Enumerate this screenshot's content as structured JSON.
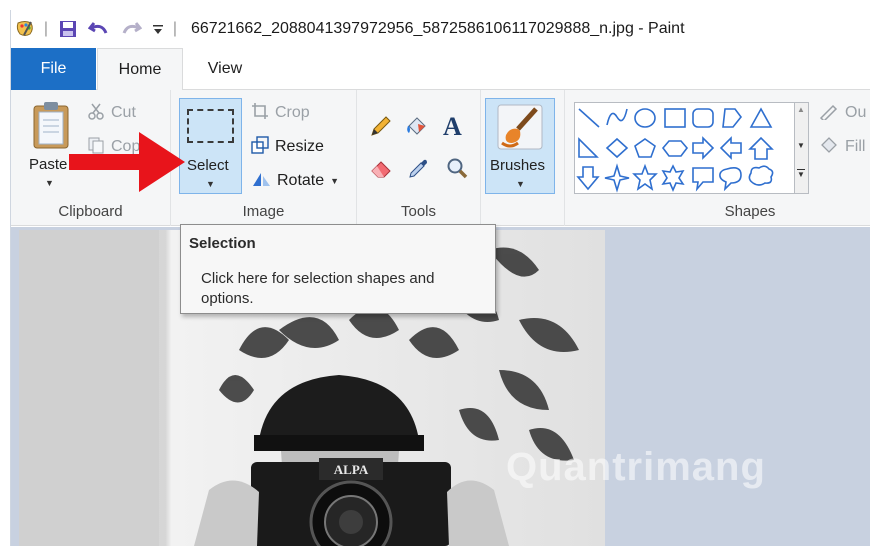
{
  "window": {
    "title": "66721662_2088041397972956_5872586106117029888_n.jpg - Paint"
  },
  "tabs": [
    {
      "label": "File"
    },
    {
      "label": "Home"
    },
    {
      "label": "View"
    }
  ],
  "clipboard": {
    "paste_label": "Paste",
    "cut_label": "Cut",
    "copy_label": "Copy",
    "group_label": "Clipboard"
  },
  "image": {
    "select_label": "Select",
    "crop_label": "Crop",
    "resize_label": "Resize",
    "rotate_label": "Rotate",
    "group_label": "Image"
  },
  "tools": {
    "group_label": "Tools",
    "text_glyph": "A"
  },
  "brushes": {
    "label": "Brushes"
  },
  "shapes": {
    "group_label": "Shapes",
    "outline_label": "Ou",
    "fill_label": "Fill"
  },
  "tooltip": {
    "title": "Selection",
    "body": "Click here for selection shapes and options."
  },
  "watermark": {
    "text": "Quantrimang"
  },
  "photo": {
    "camera_brand": "ALPA"
  },
  "colors": {
    "accent": "#1c6fc6",
    "arrow": "#e8141b",
    "selected_bg": "#cce4f7",
    "canvas_bg": "#c8d1e0"
  }
}
